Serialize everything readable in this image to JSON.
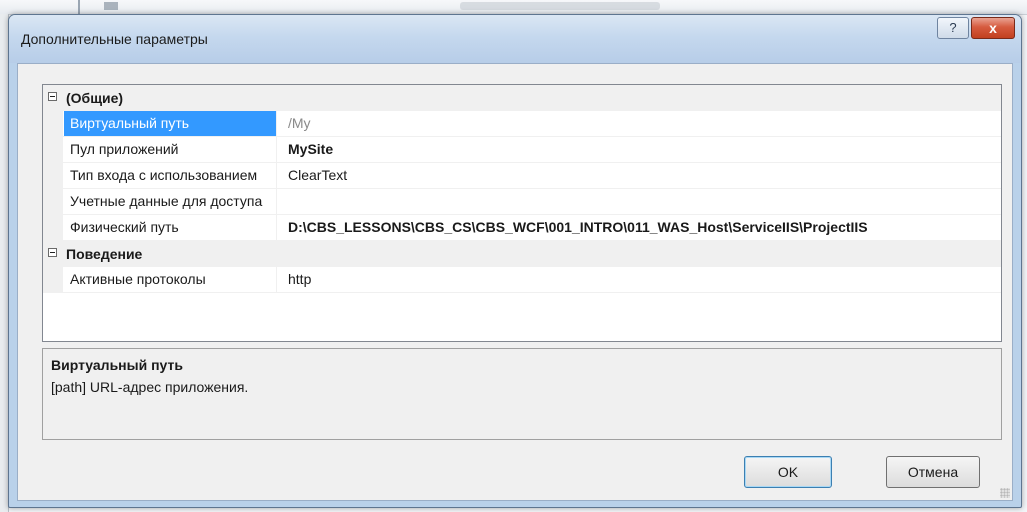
{
  "dialog": {
    "title": "Дополнительные параметры",
    "help_label": "?",
    "close_label": "x"
  },
  "grid": {
    "categories": [
      {
        "label": "(Общие)",
        "properties": [
          {
            "name": "Виртуальный путь",
            "value": "/My"
          },
          {
            "name": "Пул приложений",
            "value": "MySite"
          },
          {
            "name": "Тип входа с использованием",
            "value": "ClearText"
          },
          {
            "name": "Учетные данные для доступа",
            "value": ""
          },
          {
            "name": "Физический путь",
            "value": "D:\\CBS_LESSONS\\CBS_CS\\CBS_WCF\\001_INTRO\\011_WAS_Host\\ServiceIIS\\ProjectIIS"
          }
        ]
      },
      {
        "label": "Поведение",
        "properties": [
          {
            "name": "Активные протоколы",
            "value": "http"
          }
        ]
      }
    ]
  },
  "description": {
    "title": "Виртуальный путь",
    "text": "[path] URL-адрес приложения."
  },
  "buttons": {
    "ok_label": "OK",
    "cancel_label": "Отмена"
  },
  "colors": {
    "selection": "#3399ff",
    "close_button": "#c2401f"
  }
}
